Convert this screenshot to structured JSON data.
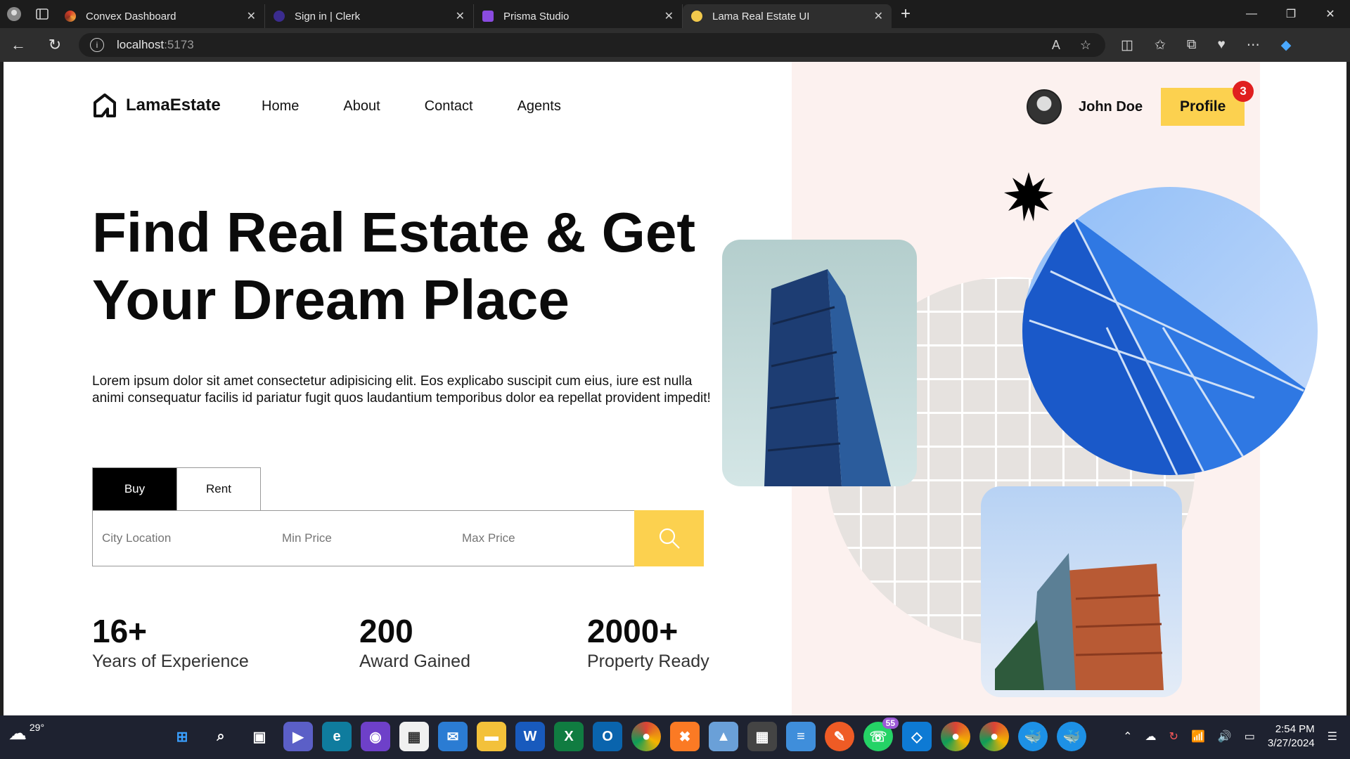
{
  "browser": {
    "tabs": [
      {
        "title": "Convex Dashboard",
        "color": "#8a2f1f"
      },
      {
        "title": "Sign in | Clerk",
        "color": "#5a4fd6"
      },
      {
        "title": "Prisma Studio",
        "color": "#8a4be0"
      },
      {
        "title": "Lama Real Estate UI",
        "color": "#f2c94c"
      }
    ],
    "url_host": "localhost",
    "url_port": ":5173"
  },
  "site": {
    "logo_text": "LamaEstate",
    "nav": [
      "Home",
      "About",
      "Contact",
      "Agents"
    ],
    "user_name": "John Doe",
    "profile_label": "Profile",
    "notification_count": "3",
    "hero_line1": "Find Real Estate & Get",
    "hero_line2": "Your Dream Place",
    "description": "Lorem ipsum dolor sit amet consectetur adipisicing elit. Eos explicabo suscipit cum eius, iure est nulla animi consequatur facilis id pariatur fugit quos laudantium temporibus dolor ea repellat provident impedit!",
    "search_tabs": {
      "buy": "Buy",
      "rent": "Rent"
    },
    "placeholders": {
      "city": "City Location",
      "min": "Min Price",
      "max": "Max Price"
    },
    "stats": [
      {
        "number": "16+",
        "label": "Years of Experience"
      },
      {
        "number": "200",
        "label": "Award Gained"
      },
      {
        "number": "2000+",
        "label": "Property Ready"
      }
    ],
    "accent": "#fcd14f"
  },
  "taskbar": {
    "temperature": "29°",
    "whatsapp_badge": "55",
    "time": "2:54 PM",
    "date": "3/27/2024"
  }
}
